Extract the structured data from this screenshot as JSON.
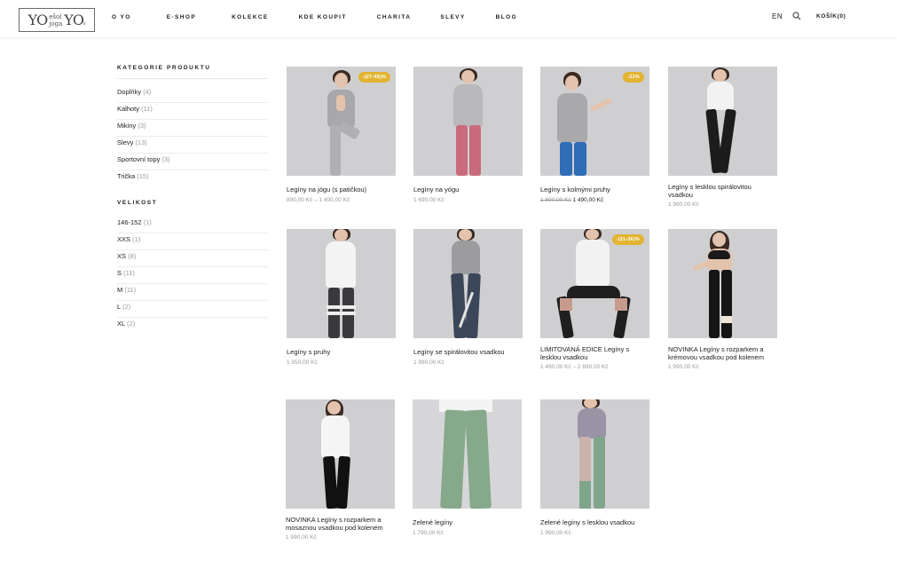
{
  "header": {
    "logo": {
      "left": "YO",
      "mid_top": "ešol",
      "mid_bottom": "joga",
      "right": "YO",
      "dot": "s"
    },
    "nav": [
      "O YO",
      "E-SHOP",
      "KOLEKCE",
      "KDE KOUPIT",
      "CHARITA",
      "SLEVY",
      "BLOG"
    ],
    "lang": "EN",
    "cart": "KOŠÍK(0)"
  },
  "sidebar": {
    "categories_title": "KATEGORIE PRODUKTU",
    "categories": [
      {
        "name": "Doplňky",
        "count": "(4)"
      },
      {
        "name": "Kalhoty",
        "count": "(11)"
      },
      {
        "name": "Mikiny",
        "count": "(3)"
      },
      {
        "name": "Slevy",
        "count": "(13)"
      },
      {
        "name": "Sportovní topy",
        "count": "(3)"
      },
      {
        "name": "Trička",
        "count": "(15)"
      }
    ],
    "size_title": "VELIKOST",
    "sizes": [
      {
        "name": "146-152",
        "count": "(1)"
      },
      {
        "name": "XXS",
        "count": "(1)"
      },
      {
        "name": "XS",
        "count": "(8)"
      },
      {
        "name": "S",
        "count": "(11)"
      },
      {
        "name": "M",
        "count": "(11)"
      },
      {
        "name": "L",
        "count": "(2)"
      },
      {
        "name": "XL",
        "count": "(2)"
      }
    ]
  },
  "products": [
    {
      "name": "Legíny na jógu (s patičkou)",
      "price": "890,00 Kč – 1 490,00 Kč",
      "old_price": "",
      "badge": "-(27-40)%"
    },
    {
      "name": "Legíny na yógu",
      "price": "1 690,00 Kč",
      "old_price": "",
      "badge": ""
    },
    {
      "name": "Legíny s kolmými pruhy",
      "price": "1 490,00 Kč",
      "old_price": "1 890,00 Kč",
      "badge": "-21%"
    },
    {
      "name": "Legíny s lesklou spirálovitou vsadkou",
      "price": "1 990,00 Kč",
      "old_price": "",
      "badge": ""
    },
    {
      "name": "Legíny s pruhy",
      "price": "1 950,00 Kč",
      "old_price": "",
      "badge": ""
    },
    {
      "name": "Legíny se spirálovitou vsadkou",
      "price": "1 990,00 Kč",
      "old_price": "",
      "badge": ""
    },
    {
      "name": "LIMITOVANÁ EDICE Legíny s lesklou vsadkou",
      "price": "1 490,00 Kč – 2 690,00 Kč",
      "old_price": "",
      "badge": "-(21-26)%"
    },
    {
      "name": "NOVINKA Legíny s rozparkem a krémovou vsadkou pod kolenem",
      "price": "1 990,00 Kč",
      "old_price": "",
      "badge": ""
    },
    {
      "name": "NOVINKA Legíny s rozparkem a mosaznou vsadkou pod kolenem",
      "price": "1 990,00 Kč",
      "old_price": "",
      "badge": ""
    },
    {
      "name": "Zelené legíny",
      "price": "1 790,00 Kč",
      "old_price": "",
      "badge": ""
    },
    {
      "name": "Zelené legíny s lesklou vsadkou",
      "price": "1 990,00 Kč",
      "old_price": "",
      "badge": ""
    }
  ],
  "icons": {
    "search": "search-icon"
  },
  "colors": {
    "badge": "#e2b431",
    "image_bg": "#cfcfd1"
  }
}
